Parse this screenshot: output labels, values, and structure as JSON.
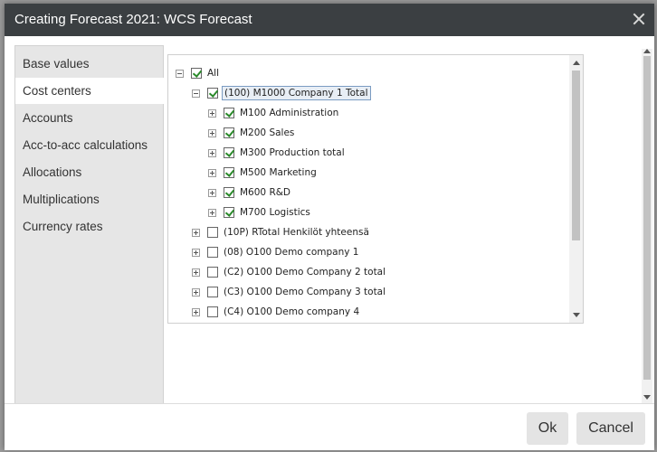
{
  "dialog": {
    "title": "Creating Forecast 2021: WCS Forecast"
  },
  "sidebar": {
    "items": [
      {
        "label": "Base values"
      },
      {
        "label": "Cost centers"
      },
      {
        "label": "Accounts"
      },
      {
        "label": "Acc-to-acc calculations"
      },
      {
        "label": "Allocations"
      },
      {
        "label": "Multiplications"
      },
      {
        "label": "Currency rates"
      }
    ],
    "active": "Cost centers"
  },
  "tree": {
    "root": {
      "label": "All",
      "checked": true,
      "expanded": true
    },
    "company": {
      "label": "(100) M1000 Company 1 Total",
      "checked": true,
      "expanded": true,
      "selected": true
    },
    "children": [
      {
        "label": "M100 Administration",
        "checked": true
      },
      {
        "label": "M200 Sales",
        "checked": true
      },
      {
        "label": "M300 Production total",
        "checked": true
      },
      {
        "label": "M500 Marketing",
        "checked": true
      },
      {
        "label": "M600 R&D",
        "checked": true
      },
      {
        "label": "M700 Logistics",
        "checked": true
      }
    ],
    "others": [
      {
        "label": "(10P) RTotal Henkilöt yhteensä",
        "checked": false
      },
      {
        "label": "(08) O100 Demo company 1",
        "checked": false
      },
      {
        "label": "(C2) O100 Demo Company 2 total",
        "checked": false
      },
      {
        "label": "(C3) O100 Demo Company 3 total",
        "checked": false
      },
      {
        "label": "(C4) O100 Demo company 4",
        "checked": false
      }
    ]
  },
  "footer": {
    "ok_label": "Ok",
    "cancel_label": "Cancel"
  }
}
